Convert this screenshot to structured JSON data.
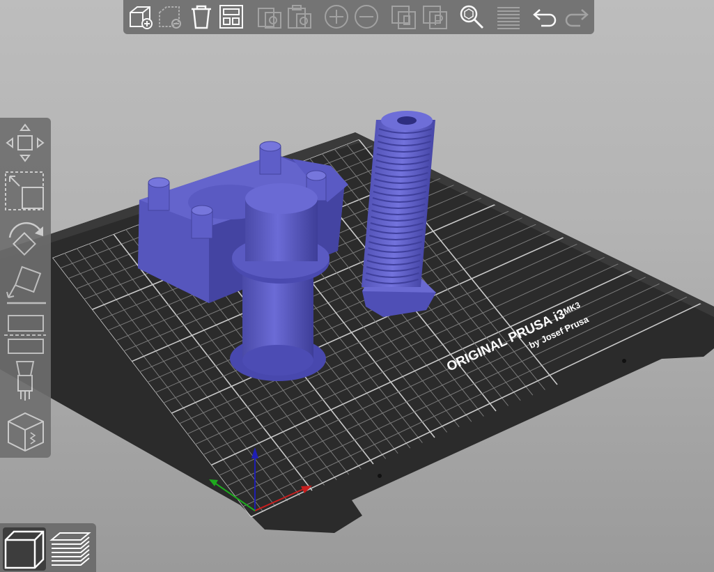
{
  "toolbar": {
    "items": [
      {
        "name": "add-object",
        "enabled": true
      },
      {
        "name": "delete",
        "enabled": false
      },
      {
        "name": "delete-all",
        "enabled": true
      },
      {
        "name": "arrange",
        "enabled": true
      },
      {
        "name": "copy",
        "enabled": false
      },
      {
        "name": "paste",
        "enabled": false
      },
      {
        "name": "add-instance",
        "enabled": false
      },
      {
        "name": "remove-instance",
        "enabled": false
      },
      {
        "name": "split-to-objects",
        "enabled": false
      },
      {
        "name": "split-to-parts",
        "enabled": false
      },
      {
        "name": "search",
        "enabled": true
      },
      {
        "name": "layer-editing",
        "enabled": false
      },
      {
        "name": "undo",
        "enabled": true
      },
      {
        "name": "redo",
        "enabled": false
      }
    ]
  },
  "left_toolbar": {
    "items": [
      "move",
      "scale",
      "rotate",
      "place-on-face",
      "cut",
      "paint-supports",
      "paint-seam"
    ]
  },
  "view_toggle": {
    "active": "3d-view",
    "items": [
      "3d-view",
      "preview"
    ]
  },
  "bed": {
    "logo_main": "ORIGINAL PRUSA i3",
    "logo_model": "MK3",
    "logo_sub": "by Josef Prusa"
  },
  "colors": {
    "model": "#5e5ec8",
    "bed": "#2b2b2b",
    "background_top": "#bdbdbd",
    "background_bottom": "#9a9a9a",
    "toolbar": "#6e6e6e",
    "axis_x": "#c81e1e",
    "axis_y": "#1eaa1e",
    "axis_z": "#1e1eb4"
  }
}
